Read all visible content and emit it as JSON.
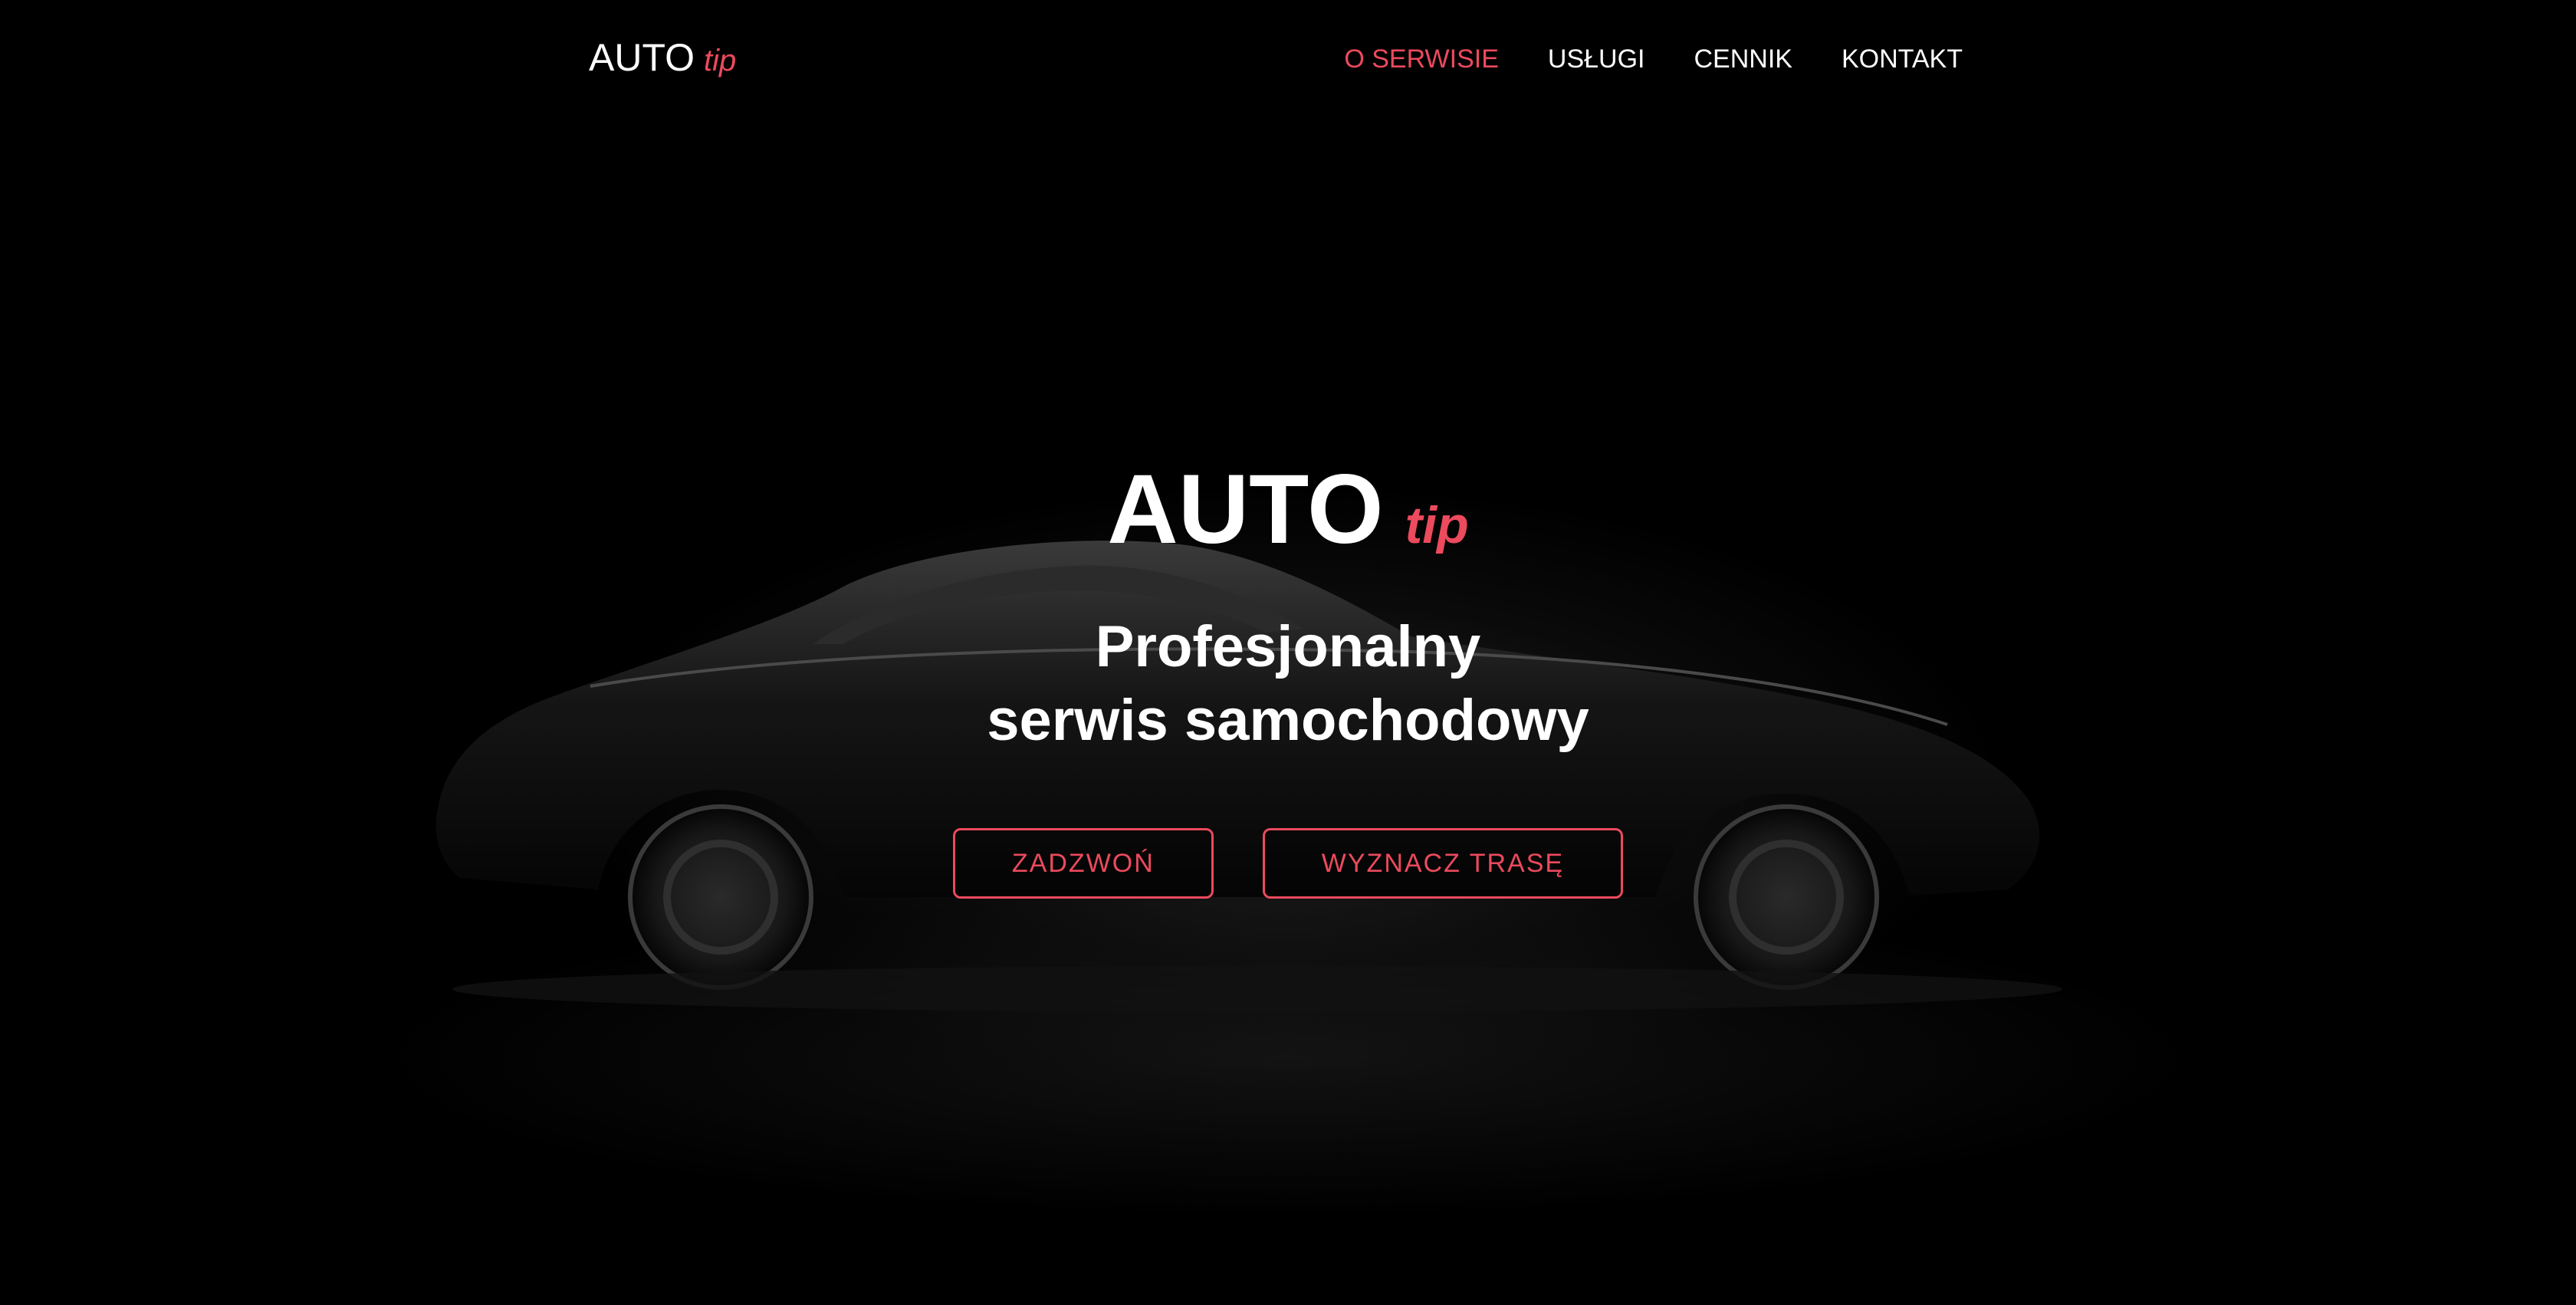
{
  "colors": {
    "accent": "#ec4a5d",
    "background": "#000000",
    "text": "#ffffff"
  },
  "header": {
    "logo": {
      "main": "AUTO",
      "accent": "tip"
    },
    "nav": [
      {
        "label": "O SERWISIE",
        "active": true
      },
      {
        "label": "USŁUGI",
        "active": false
      },
      {
        "label": "CENNIK",
        "active": false
      },
      {
        "label": "KONTAKT",
        "active": false
      }
    ]
  },
  "hero": {
    "title": {
      "main": "AUTO",
      "accent": "tip"
    },
    "subtitle_line1": "Profesjonalny",
    "subtitle_line2": "serwis samochodowy",
    "buttons": {
      "call": "ZADZWOŃ",
      "route": "WYZNACZ TRASĘ"
    },
    "background_image": "dark car silhouette"
  }
}
